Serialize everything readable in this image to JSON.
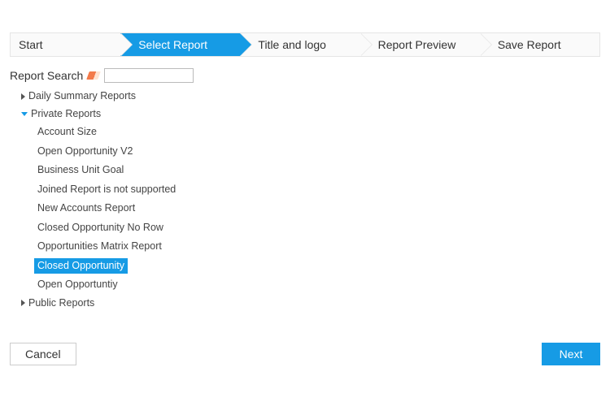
{
  "colors": {
    "accent": "#169be5"
  },
  "wizard": {
    "steps": [
      {
        "label": "Start",
        "active": false
      },
      {
        "label": "Select Report",
        "active": true
      },
      {
        "label": "Title and logo",
        "active": false
      },
      {
        "label": "Report Preview",
        "active": false
      },
      {
        "label": "Save Report",
        "active": false
      }
    ]
  },
  "search": {
    "label": "Report Search",
    "icon": "eraser-icon",
    "value": "",
    "placeholder": ""
  },
  "tree": [
    {
      "label": "Daily Summary Reports",
      "expanded": false,
      "children": []
    },
    {
      "label": "Private Reports",
      "expanded": true,
      "children": [
        {
          "label": "Account Size",
          "selected": false
        },
        {
          "label": "Open Opportunity V2",
          "selected": false
        },
        {
          "label": "Business Unit Goal",
          "selected": false
        },
        {
          "label": "Joined Report is not supported",
          "selected": false
        },
        {
          "label": "New Accounts Report",
          "selected": false
        },
        {
          "label": "Closed Opportunity No Row",
          "selected": false
        },
        {
          "label": "Opportunities Matrix Report",
          "selected": false
        },
        {
          "label": "Closed Opportunity",
          "selected": true
        },
        {
          "label": "Open Opportuntiy",
          "selected": false
        }
      ]
    },
    {
      "label": "Public Reports",
      "expanded": false,
      "children": []
    }
  ],
  "buttons": {
    "cancel": "Cancel",
    "next": "Next"
  }
}
